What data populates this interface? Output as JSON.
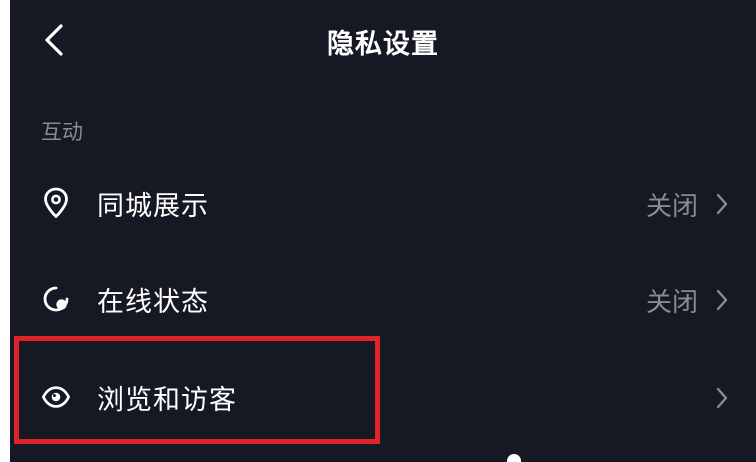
{
  "header": {
    "title": "隐私设置",
    "back_icon": "chevron-left-icon"
  },
  "section": {
    "label": "互动"
  },
  "rows": [
    {
      "label": "同城展示",
      "value": "关闭",
      "icon": "location-pin-icon"
    },
    {
      "label": "在线状态",
      "value": "关闭",
      "icon": "online-status-icon"
    },
    {
      "label": "浏览和访客",
      "value": "",
      "icon": "eye-icon"
    }
  ],
  "colors": {
    "background": "#161823",
    "text": "#ffffff",
    "secondary_text": "#8a8b91",
    "highlight_border": "#e0222b"
  }
}
